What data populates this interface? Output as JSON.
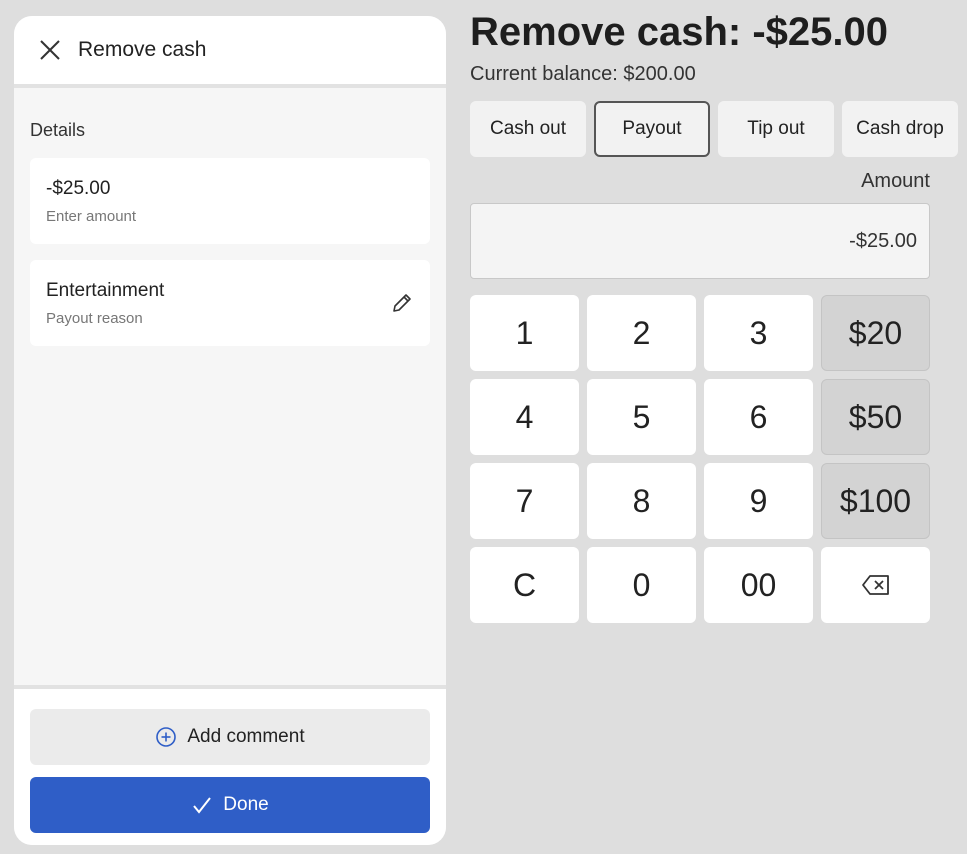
{
  "panel": {
    "title": "Remove cash",
    "details_label": "Details",
    "amount_value": "-$25.00",
    "amount_hint": "Enter amount",
    "reason_value": "Entertainment",
    "reason_hint": "Payout reason",
    "add_comment_label": "Add comment",
    "done_label": "Done"
  },
  "main": {
    "title": "Remove cash: -$25.00",
    "balance": "Current balance: $200.00",
    "types": [
      "Cash out",
      "Payout",
      "Tip out",
      "Cash drop"
    ],
    "selected_type": "Payout",
    "amount_label": "Amount",
    "amount_value": "-$25.00"
  },
  "keypad": {
    "k1": "1",
    "k2": "2",
    "k3": "3",
    "q20": "$20",
    "k4": "4",
    "k5": "5",
    "k6": "6",
    "q50": "$50",
    "k7": "7",
    "k8": "8",
    "k9": "9",
    "q100": "$100",
    "clear": "C",
    "k0": "0",
    "k00": "00",
    "backspace_icon": "backspace-icon"
  },
  "colors": {
    "accent": "#2f5ec7",
    "background": "#dedede",
    "quick_key": "#d3d3d3"
  }
}
